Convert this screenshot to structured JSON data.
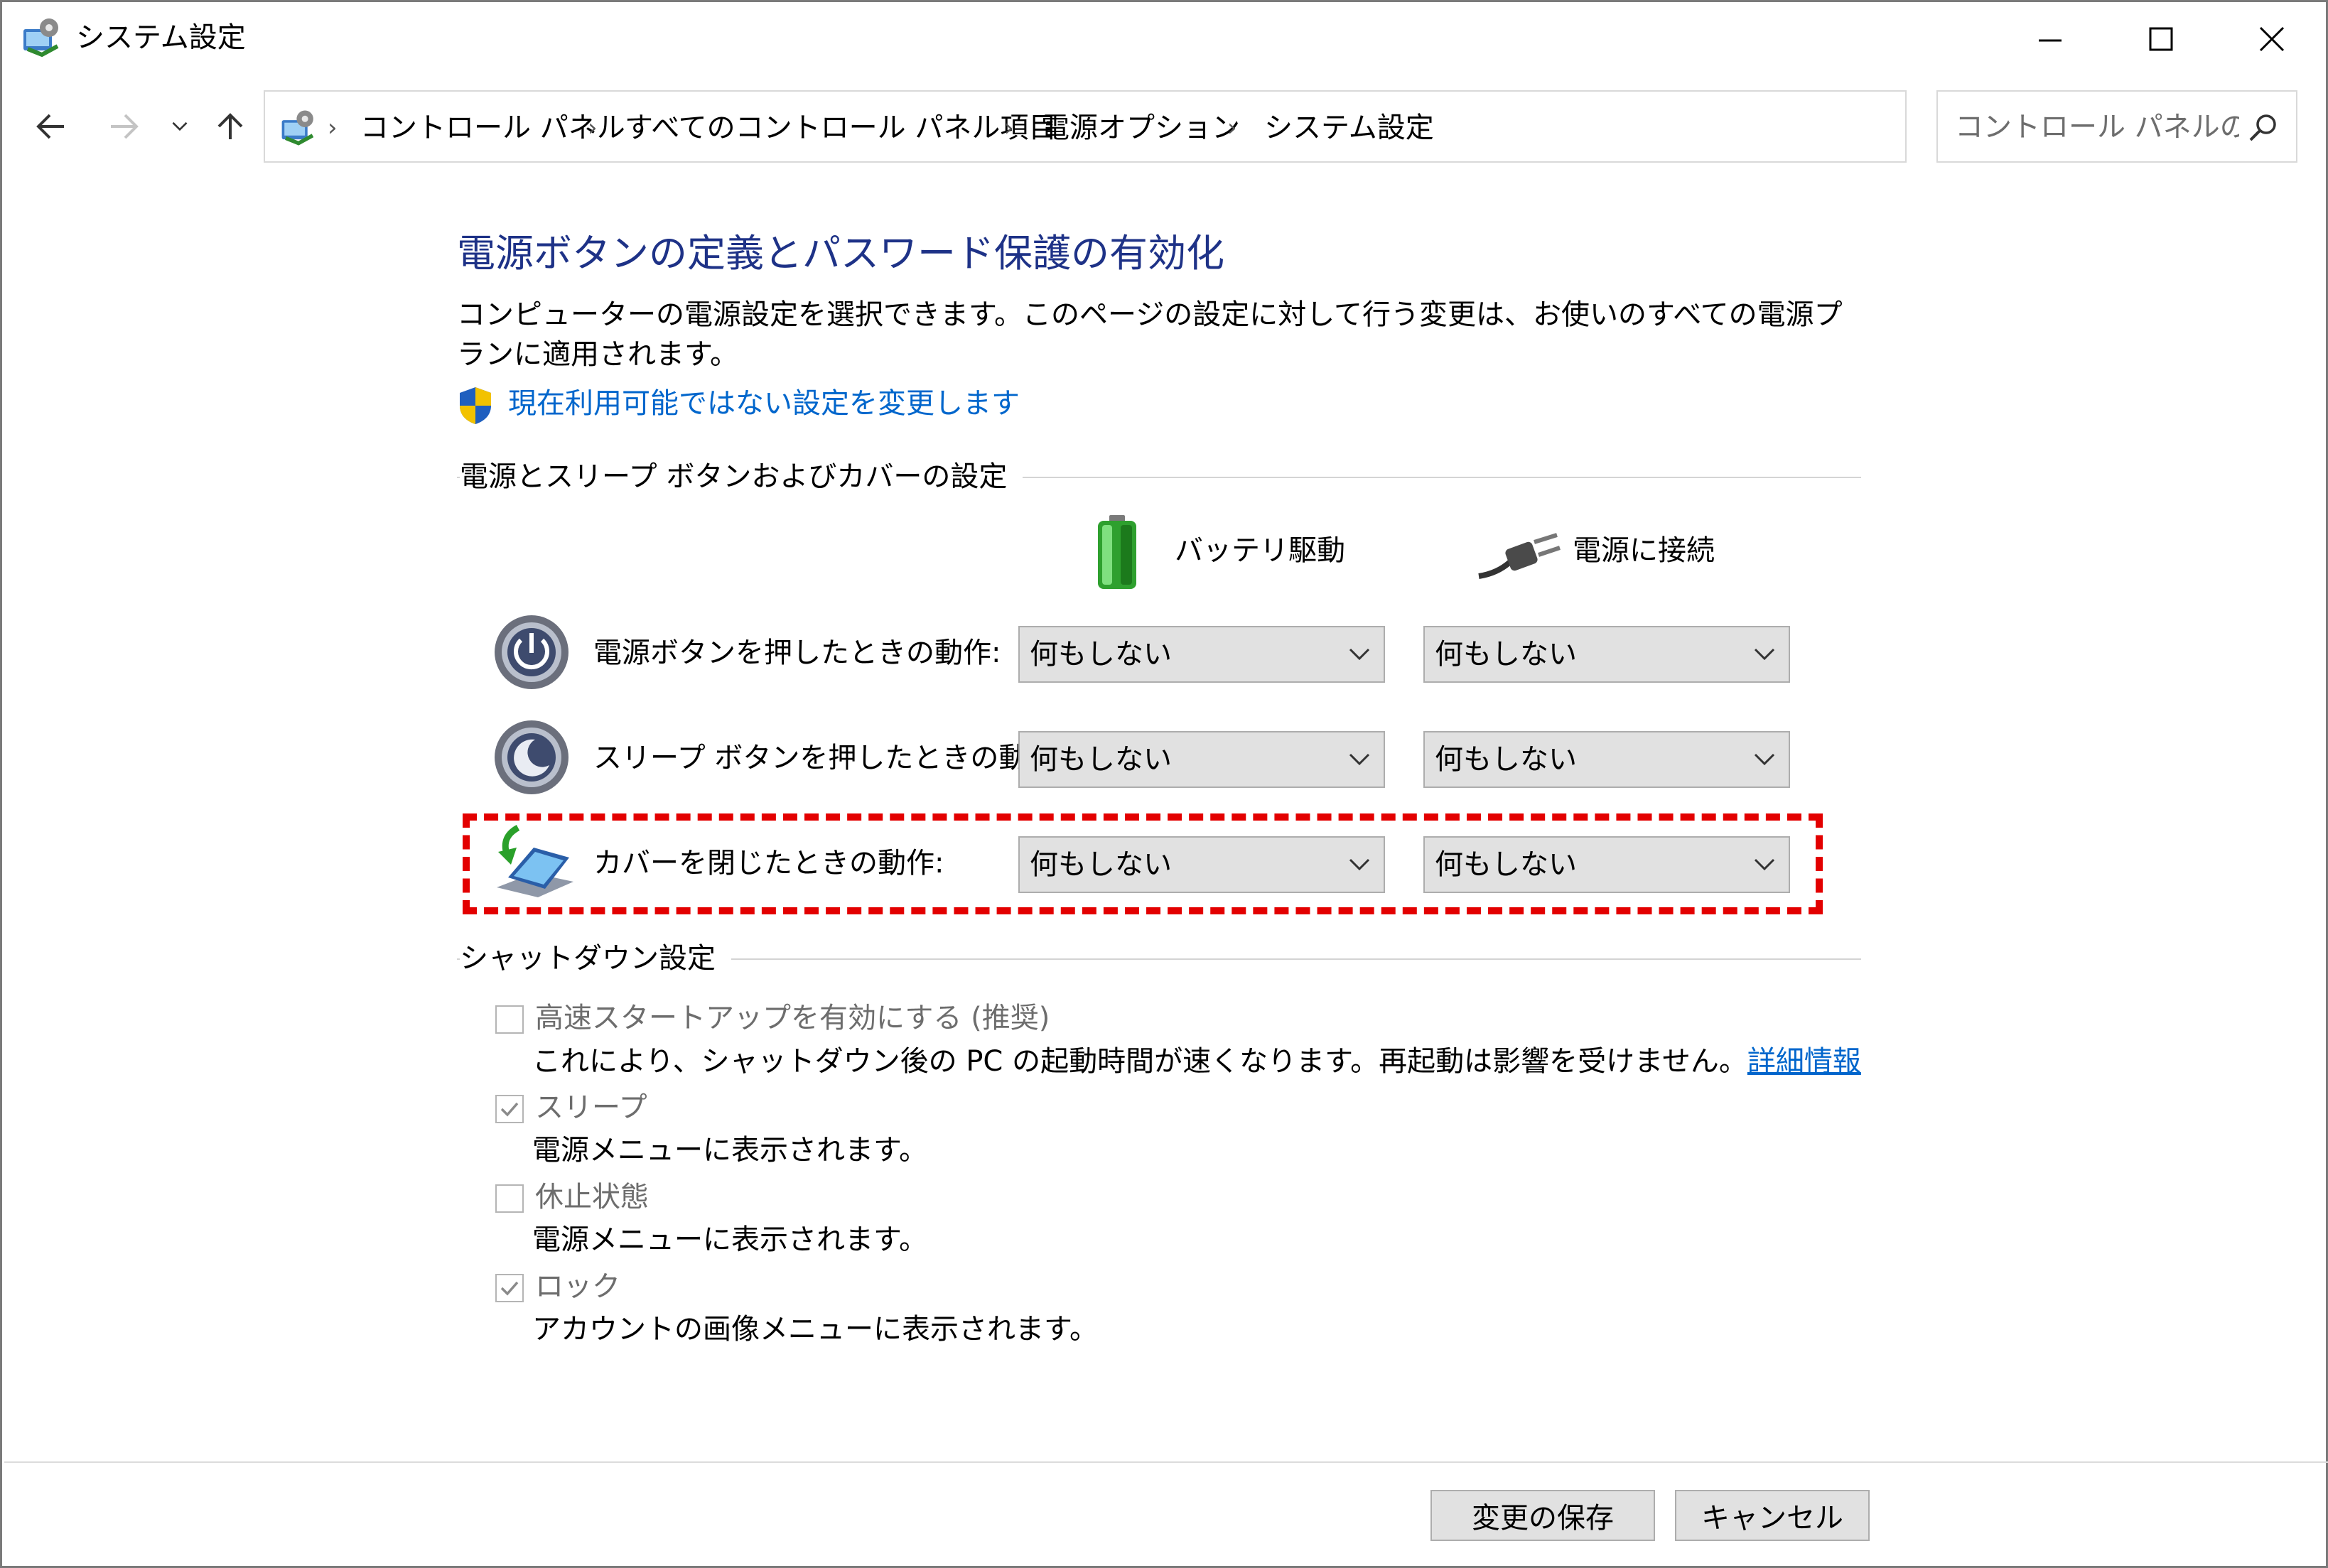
{
  "window": {
    "title": "システム設定"
  },
  "nav": {
    "breadcrumbs": [
      "コントロール パネル",
      "すべてのコントロール パネル項目",
      "電源オプション",
      "システム設定"
    ],
    "search_placeholder": "コントロール パネルの..."
  },
  "page": {
    "heading": "電源ボタンの定義とパスワード保護の有効化",
    "description": "コンピューターの電源設定を選択できます。このページの設定に対して行う変更は、お使いのすべての電源プランに適用されます。",
    "change_settings_link": "現在利用可能ではない設定を変更します"
  },
  "buttons_section": {
    "title": "電源とスリープ ボタンおよびカバーの設定",
    "columns": [
      "バッテリ駆動",
      "電源に接続"
    ],
    "rows": [
      {
        "label": "電源ボタンを押したときの動作:",
        "battery": "何もしない",
        "plugged": "何もしない"
      },
      {
        "label": "スリープ ボタンを押したときの動作:",
        "battery": "何もしない",
        "plugged": "何もしない"
      },
      {
        "label": "カバーを閉じたときの動作:",
        "battery": "何もしない",
        "plugged": "何もしない"
      }
    ]
  },
  "shutdown_section": {
    "title": "シャットダウン設定",
    "items": [
      {
        "label": "高速スタートアップを有効にする (推奨)",
        "checked": false,
        "desc": "これにより、シャットダウン後の PC の起動時間が速くなります。再起動は影響を受けません。",
        "link": "詳細情報"
      },
      {
        "label": "スリープ",
        "checked": true,
        "desc": "電源メニューに表示されます。"
      },
      {
        "label": "休止状態",
        "checked": false,
        "desc": "電源メニューに表示されます。"
      },
      {
        "label": "ロック",
        "checked": true,
        "desc": "アカウントの画像メニューに表示されます。"
      }
    ]
  },
  "footer": {
    "save_label": "変更の保存",
    "cancel_label": "キャンセル"
  },
  "colors": {
    "heading": "#1e3287",
    "link": "#0066cc",
    "highlight": "#e30000",
    "disabled_text": "#6d6d6d"
  },
  "icons": [
    "control-panel-icon",
    "back-arrow-icon",
    "forward-arrow-icon",
    "recent-dropdown-icon",
    "up-arrow-icon",
    "refresh-icon",
    "search-icon",
    "uac-shield-icon",
    "battery-icon",
    "power-plug-icon",
    "power-button-icon",
    "sleep-button-icon",
    "laptop-lid-icon"
  ]
}
